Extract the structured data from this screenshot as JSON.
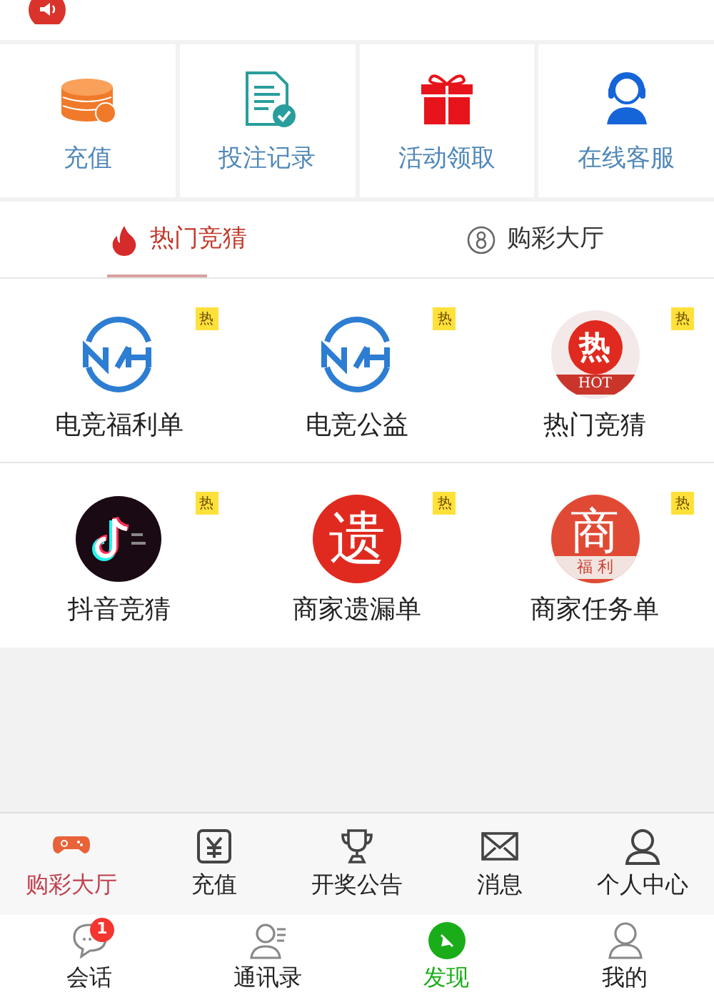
{
  "quick_actions": [
    {
      "label": "充值",
      "kind": "coins"
    },
    {
      "label": "投注记录",
      "kind": "document"
    },
    {
      "label": "活动领取",
      "kind": "gift"
    },
    {
      "label": "在线客服",
      "kind": "agent"
    }
  ],
  "tabs": [
    {
      "label": "热门竞猜",
      "kind": "flame",
      "selected": true
    },
    {
      "label": "购彩大厅",
      "kind": "eight",
      "selected": false
    }
  ],
  "games": [
    {
      "label": "电竞福利单",
      "kind": "nh",
      "badge": "热"
    },
    {
      "label": "电竞公益",
      "kind": "nh",
      "badge": "热"
    },
    {
      "label": "热门竞猜",
      "kind": "hot",
      "badge": "热",
      "logo_text": "热",
      "logo_caption": "HOT"
    },
    {
      "label": "抖音竞猜",
      "kind": "note",
      "badge": "热"
    },
    {
      "label": "商家遗漏单",
      "kind": "char",
      "badge": "热",
      "logo_text": "遗"
    },
    {
      "label": "商家任务单",
      "kind": "char",
      "badge": "热",
      "logo_text": "商",
      "logo_caption": "福 利"
    }
  ],
  "app_nav": [
    {
      "label": "购彩大厅",
      "kind": "gamepad",
      "selected": true
    },
    {
      "label": "充值",
      "kind": "yen",
      "selected": false
    },
    {
      "label": "开奖公告",
      "kind": "trophy",
      "selected": false
    },
    {
      "label": "消息",
      "kind": "mail",
      "selected": false
    },
    {
      "label": "个人中心",
      "kind": "person",
      "selected": false
    }
  ],
  "wechat_nav": [
    {
      "label": "会话",
      "kind": "chat",
      "badge": "1",
      "selected": false
    },
    {
      "label": "通讯录",
      "kind": "contacts",
      "selected": false
    },
    {
      "label": "发现",
      "kind": "compass",
      "selected": true
    },
    {
      "label": "我的",
      "kind": "me",
      "selected": false
    }
  ]
}
